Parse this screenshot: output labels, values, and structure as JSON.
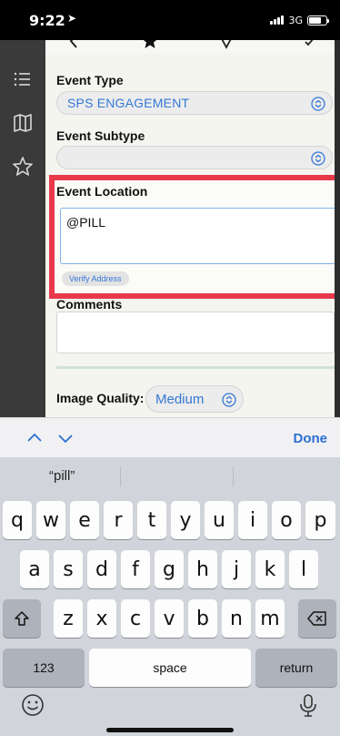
{
  "status_bar": {
    "time": "9:22",
    "network": "3G",
    "battery_level": 0.7
  },
  "form": {
    "event_type": {
      "label": "Event Type",
      "value": "SPS ENGAGEMENT"
    },
    "event_subtype": {
      "label": "Event Subtype",
      "value": ""
    },
    "event_location": {
      "label": "Event Location",
      "value": "@PILL",
      "verify_label": "Verify Address"
    },
    "comments": {
      "label": "Comments",
      "value": ""
    },
    "image_quality": {
      "label": "Image Quality:",
      "value": "Medium"
    }
  },
  "accessory": {
    "done_label": "Done"
  },
  "keyboard": {
    "suggestions": [
      "“pill”",
      "",
      ""
    ],
    "row1": [
      "q",
      "w",
      "e",
      "r",
      "t",
      "y",
      "u",
      "i",
      "o",
      "p"
    ],
    "row2": [
      "a",
      "s",
      "d",
      "f",
      "g",
      "h",
      "j",
      "k",
      "l"
    ],
    "row3": [
      "z",
      "x",
      "c",
      "v",
      "b",
      "n",
      "m"
    ],
    "numbers_label": "123",
    "space_label": "space",
    "return_label": "return"
  },
  "colors": {
    "accent": "#3478d6",
    "highlight": "#e8394b"
  },
  "icons": [
    "list-icon",
    "map-icon",
    "star-icon",
    "shift-icon",
    "backspace-icon",
    "emoji-icon",
    "microphone-icon"
  ]
}
